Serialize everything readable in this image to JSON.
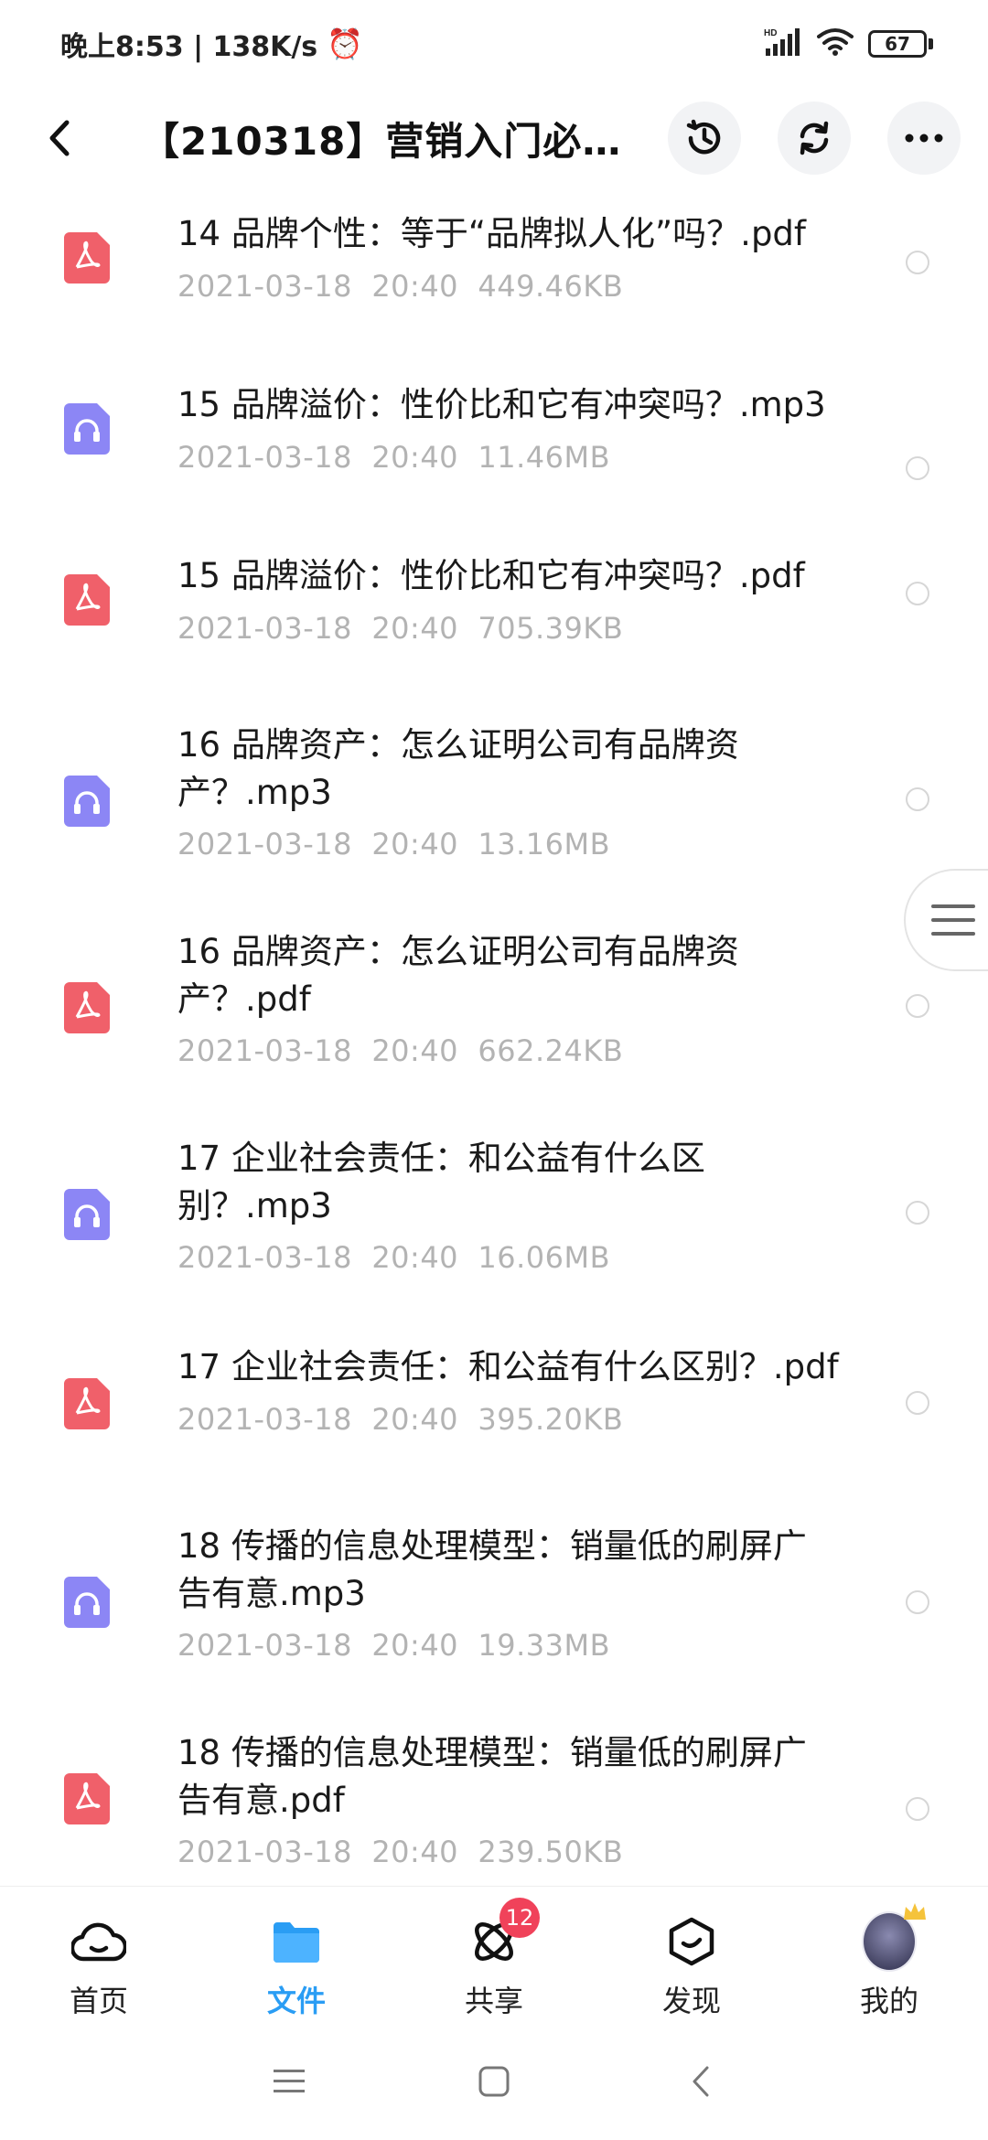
{
  "status_bar": {
    "time_speed": "晚上8:53 | 138K/s",
    "signal_label": "HD",
    "battery": "67"
  },
  "header": {
    "title": "【210318】营销入门必学..."
  },
  "files": [
    {
      "name": "14 品牌个性：等于“品牌拟人化”吗？.pdf",
      "date": "2021-03-18",
      "time": "20:40",
      "size": "449.46KB",
      "type": "pdf"
    },
    {
      "name": "15 品牌溢价：性价比和它有冲突吗？.mp3",
      "date": "2021-03-18",
      "time": "20:40",
      "size": "11.46MB",
      "type": "audio"
    },
    {
      "name": "15 品牌溢价：性价比和它有冲突吗？.pdf",
      "date": "2021-03-18",
      "time": "20:40",
      "size": "705.39KB",
      "type": "pdf"
    },
    {
      "name": "16 品牌资产：怎么证明公司有品牌资产？.mp3",
      "date": "2021-03-18",
      "time": "20:40",
      "size": "13.16MB",
      "type": "audio"
    },
    {
      "name": "16 品牌资产：怎么证明公司有品牌资产？.pdf",
      "date": "2021-03-18",
      "time": "20:40",
      "size": "662.24KB",
      "type": "pdf"
    },
    {
      "name": "17 企业社会责任：和公益有什么区别？.mp3",
      "date": "2021-03-18",
      "time": "20:40",
      "size": "16.06MB",
      "type": "audio"
    },
    {
      "name": "17 企业社会责任：和公益有什么区别？.pdf",
      "date": "2021-03-18",
      "time": "20:40",
      "size": "395.20KB",
      "type": "pdf"
    },
    {
      "name": "18 传播的信息处理模型：销量低的刷屏广告有意.mp3",
      "date": "2021-03-18",
      "time": "20:40",
      "size": "19.33MB",
      "type": "audio"
    },
    {
      "name": "18 传播的信息处理模型：销量低的刷屏广告有意.pdf",
      "date": "2021-03-18",
      "time": "20:40",
      "size": "239.50KB",
      "type": "pdf"
    }
  ],
  "bottom_nav": [
    {
      "label": "首页",
      "icon": "cloud-home-icon",
      "active": false
    },
    {
      "label": "文件",
      "icon": "folder-icon",
      "active": true
    },
    {
      "label": "共享",
      "icon": "share-atom-icon",
      "active": false,
      "badge": "12"
    },
    {
      "label": "发现",
      "icon": "discover-icon",
      "active": false
    },
    {
      "label": "我的",
      "icon": "avatar-icon",
      "active": false
    }
  ],
  "colors": {
    "accent": "#2a9df4",
    "pdf_icon": "#f0606a",
    "audio_icon": "#8c86f5",
    "badge": "#f0425a"
  }
}
